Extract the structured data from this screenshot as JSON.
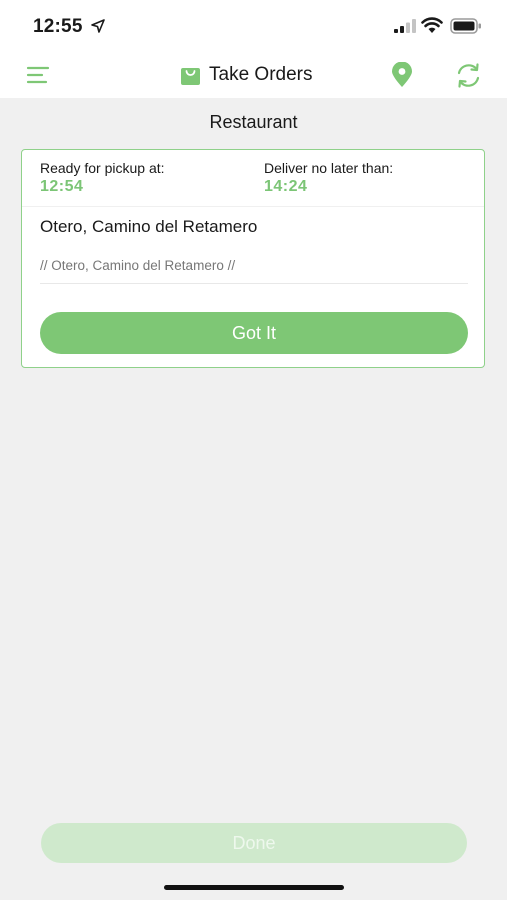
{
  "status_bar": {
    "time": "12:55",
    "icons": [
      "location-arrow-icon",
      "cellular-signal-icon",
      "wifi-icon",
      "battery-icon"
    ]
  },
  "nav": {
    "title": "Take Orders",
    "left_icon": "hamburger-menu-icon",
    "title_icon": "shopping-bag-icon",
    "right_icons": [
      "map-pin-icon",
      "refresh-icon"
    ]
  },
  "section": {
    "title": "Restaurant"
  },
  "order_card": {
    "pickup_label": "Ready for pickup at:",
    "pickup_time": "12:54",
    "deliver_label": "Deliver no later than:",
    "deliver_time": "14:24",
    "address": "Otero, Camino del Retamero",
    "address_note": "// Otero, Camino del Retamero //",
    "got_it_label": "Got It"
  },
  "footer": {
    "done_label": "Done"
  },
  "colors": {
    "accent": "#7ec775",
    "accent_text": "#7cc576",
    "card_border": "#8fd18a",
    "disabled_button": "#cfe9cc",
    "background": "#f0f0f0"
  }
}
